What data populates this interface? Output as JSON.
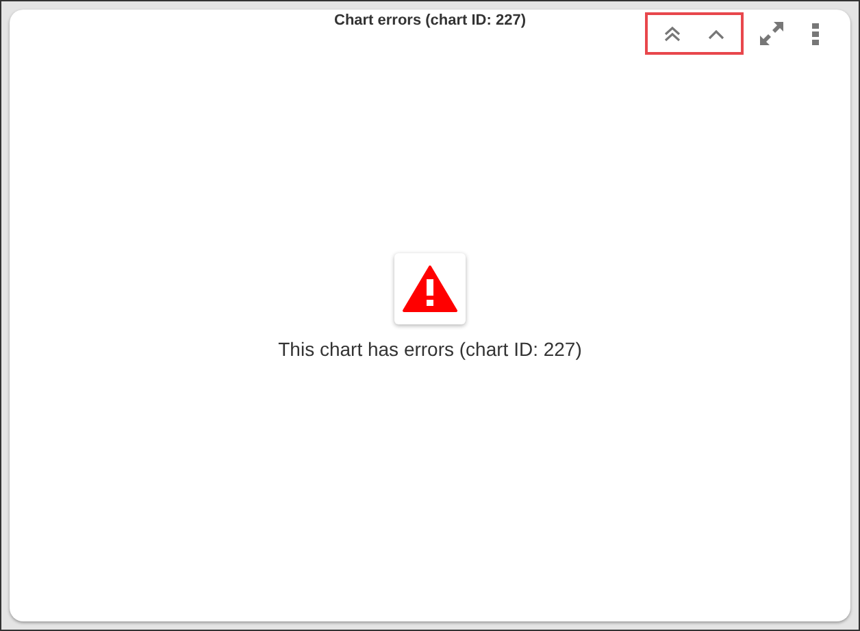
{
  "panel": {
    "title": "Chart errors (chart ID: 227)"
  },
  "toolbar": [
    {
      "kind": "double-chevron",
      "highlighted": true
    },
    {
      "kind": "chevron",
      "highlighted": true
    },
    {
      "kind": "expand",
      "highlighted": false
    },
    {
      "kind": "kebab",
      "highlighted": false
    }
  ],
  "error": {
    "message": "This chart has errors (chart ID: 227)"
  }
}
